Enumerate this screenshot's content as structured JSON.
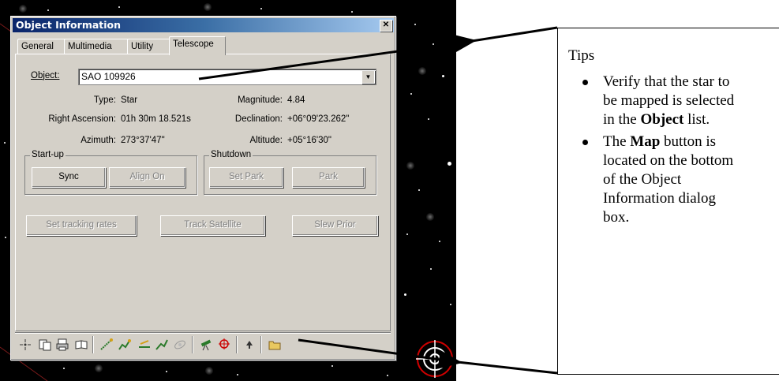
{
  "dialog": {
    "title": "Object Information",
    "close_label": "✕",
    "tabs": [
      "General",
      "Multimedia",
      "Utility",
      "Telescope"
    ],
    "active_tab": "Telescope",
    "object_label": "Object:",
    "object_value": "SAO 109926",
    "fields": {
      "type_label": "Type:",
      "type_value": "Star",
      "magnitude_label": "Magnitude:",
      "magnitude_value": "4.84",
      "ra_label": "Right Ascension:",
      "ra_value": "01h 30m 18.521s",
      "dec_label": "Declination:",
      "dec_value": "+06°09'23.262\"",
      "azimuth_label": "Azimuth:",
      "azimuth_value": "273°37'47\"",
      "altitude_label": "Altitude:",
      "altitude_value": "+05°16'30\""
    },
    "startup_group": "Start-up",
    "shutdown_group": "Shutdown",
    "buttons": {
      "sync": "Sync",
      "align_on": "Align On",
      "set_park": "Set Park",
      "park": "Park",
      "set_tracking_rates": "Set tracking rates",
      "track_satellite": "Track Satellite",
      "slew_prior": "Slew Prior"
    },
    "toolbar_icons": [
      "center-icon",
      "copy-icon",
      "print-icon",
      "book-icon",
      "measure-icon",
      "chart-icon",
      "scope-line-icon",
      "path-icon",
      "orbit-icon",
      "telescope-icon",
      "map-icon",
      "up-arrow-icon",
      "folder-icon"
    ]
  },
  "tips": {
    "title": "Tips",
    "item1_pre": "Verify that the star to be mapped is selected in the ",
    "item1_bold": "Object",
    "item1_post": " list.",
    "item2_pre": "The ",
    "item2_bold": "Map",
    "item2_post": " button is located on the bottom of the Object Information dialog box."
  },
  "colors": {
    "dialog_bg": "#d4d0c8",
    "titlebar_start": "#0a246a",
    "titlebar_end": "#a6caf0",
    "sky": "#000000",
    "reticle": "#cc0000"
  }
}
